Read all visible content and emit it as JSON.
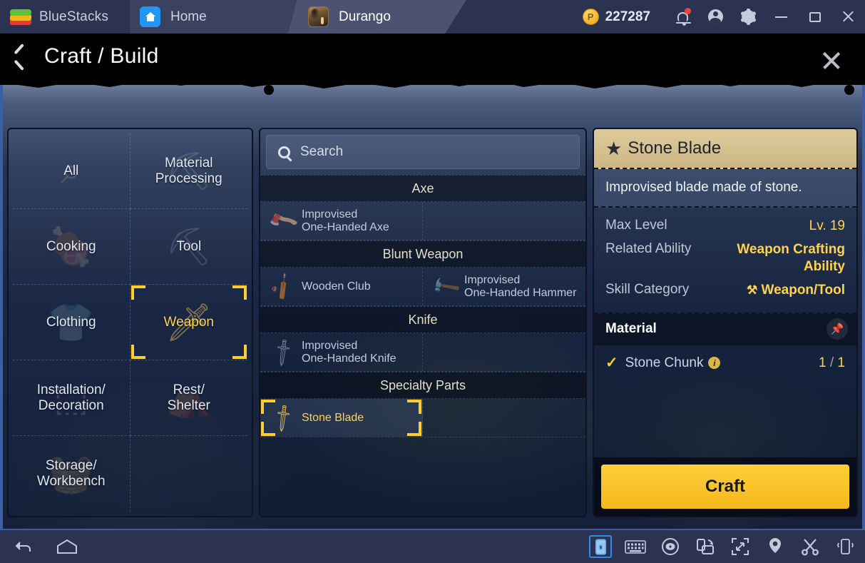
{
  "titlebar": {
    "brand": "BlueStacks",
    "tabs": [
      {
        "label": "Home",
        "icon": "home-icon",
        "active": false
      },
      {
        "label": "Durango",
        "icon": "durango-game-icon",
        "active": true
      }
    ],
    "currency": {
      "symbol": "P",
      "value": "227287"
    },
    "icons": [
      "bell-icon",
      "account-icon",
      "gear-icon",
      "minimize-icon",
      "maximize-icon",
      "close-icon"
    ]
  },
  "header": {
    "back_icon": "back-chevron-icon",
    "title": "Craft / Build",
    "close_icon": "close-icon"
  },
  "categories": {
    "cells": [
      {
        "label": "All",
        "glyph": "⌕",
        "selected": false
      },
      {
        "label": "Material\nProcessing",
        "glyph": "⛏",
        "selected": false
      },
      {
        "label": "Cooking",
        "glyph": "🍖",
        "selected": false
      },
      {
        "label": "Tool",
        "glyph": "⛏",
        "selected": false
      },
      {
        "label": "Clothing",
        "glyph": "👕",
        "selected": false
      },
      {
        "label": "Weapon",
        "glyph": "🗡",
        "selected": true
      },
      {
        "label": "Installation/\nDecoration",
        "glyph": "⬚",
        "selected": false
      },
      {
        "label": "Rest/\nShelter",
        "glyph": "⛺",
        "selected": false
      },
      {
        "label": "Storage/\nWorkbench",
        "glyph": "🧺",
        "selected": false
      },
      {
        "label": "",
        "glyph": "",
        "selected": false
      }
    ]
  },
  "search": {
    "icon": "search-icon",
    "placeholder": "Search",
    "value": ""
  },
  "recipe_list": [
    {
      "type": "section",
      "label": "Axe"
    },
    {
      "type": "row",
      "items": [
        {
          "name": "Improvised\nOne-Handed Axe",
          "glyph": "🪓",
          "selected": false
        },
        {
          "name": "",
          "glyph": "",
          "selected": false,
          "empty": true
        }
      ]
    },
    {
      "type": "section",
      "label": "Blunt Weapon"
    },
    {
      "type": "row",
      "items": [
        {
          "name": "Wooden Club",
          "glyph": "🏏",
          "selected": false
        },
        {
          "name": "Improvised\nOne-Handed Hammer",
          "glyph": "🔨",
          "selected": false
        }
      ]
    },
    {
      "type": "section",
      "label": "Knife"
    },
    {
      "type": "row",
      "items": [
        {
          "name": "Improvised\nOne-Handed Knife",
          "glyph": "🗡",
          "selected": false
        },
        {
          "name": "",
          "glyph": "",
          "selected": false,
          "empty": true
        }
      ]
    },
    {
      "type": "section",
      "label": "Specialty Parts"
    },
    {
      "type": "row",
      "items": [
        {
          "name": "Stone Blade",
          "glyph": "🗡",
          "selected": true
        },
        {
          "name": "",
          "glyph": "",
          "selected": false,
          "empty": true
        }
      ]
    }
  ],
  "detail": {
    "star_icon": "star-icon",
    "title": "Stone Blade",
    "description": "Improvised blade made of stone.",
    "stats": [
      {
        "key": "Max Level",
        "value": "Lv. 19"
      },
      {
        "key": "Related Ability",
        "value": "Weapon Crafting Ability"
      },
      {
        "key": "Skill Category",
        "value": "Weapon/Tool",
        "icon": "anvil-icon"
      }
    ],
    "material_header": {
      "label": "Material",
      "pin_icon": "pin-icon"
    },
    "materials": [
      {
        "check_icon": "check-icon",
        "name": "Stone Chunk",
        "info_icon": "info-icon",
        "have": "1",
        "need": "1",
        "separator": "/"
      }
    ],
    "craft_button": "Craft"
  },
  "bottombar": {
    "left_icons": [
      "back-icon",
      "home-icon"
    ],
    "right_icons": [
      "portrait-mode-icon",
      "keyboard-icon",
      "eye-icon",
      "rotate-icon",
      "fullscreen-icon",
      "location-pin-icon",
      "scissors-icon",
      "shake-device-icon"
    ],
    "active_right_icon": "portrait-mode-icon"
  },
  "colors": {
    "accent_yellow": "#ffcd2e",
    "panel_border": "#0c1322",
    "titlebar_bg": "#2c3350",
    "brand_blue": "#3a5ea8",
    "detail_title_bg": "#ddcb9c"
  }
}
